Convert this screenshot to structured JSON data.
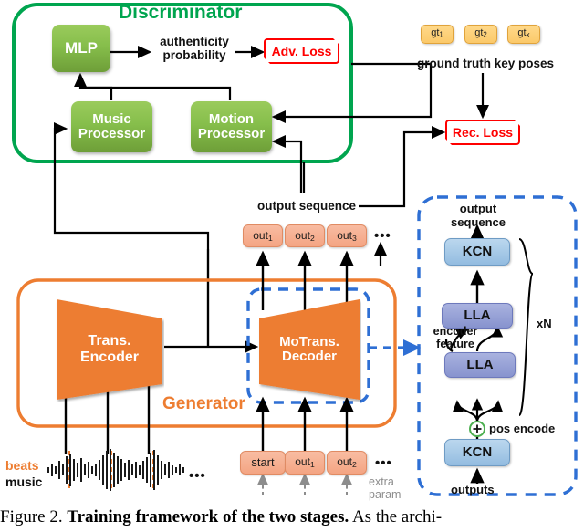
{
  "figure": {
    "caption_prefix": "Figure 2.",
    "caption_bold": "Training framework of the two stages.",
    "caption_rest": "As the archi-"
  },
  "colors": {
    "discriminator_green": "#00A54F",
    "generator_orange": "#ED7D31",
    "decoder_dashed_blue": "#2E6FD4",
    "loss_red": "#FF0000",
    "beats_orange": "#ED7D31",
    "gt_yellow": "#FBC96A",
    "out_salmon": "#F4A583",
    "kcn_blue": "#93BCE0",
    "lla_purple": "#8793CE",
    "gray_text": "#8D8D8D"
  },
  "discriminator": {
    "title": "Discriminator",
    "mlp": "MLP",
    "authenticity": "authenticity\nprobability",
    "authenticity_line1": "authenticity",
    "authenticity_line2": "probability",
    "adv_loss": "Adv. Loss",
    "music_processor_line1": "Music",
    "music_processor_line2": "Processor",
    "motion_processor_line1": "Motion",
    "motion_processor_line2": "Processor"
  },
  "ground_truth": {
    "label": "ground truth key poses",
    "boxes": [
      {
        "base": "gt",
        "sub": "1"
      },
      {
        "base": "gt",
        "sub": "2"
      },
      {
        "base": "gt",
        "sub": "x"
      }
    ]
  },
  "rec_loss": {
    "label": "Rec. Loss"
  },
  "output_sequence_label": "output sequence",
  "generator": {
    "title": "Generator",
    "encoder_line1": "Trans.",
    "encoder_line2": "Encoder",
    "decoder_line1": "MoTrans.",
    "decoder_line2": "Decoder"
  },
  "outputs_row": {
    "boxes": [
      {
        "base": "out",
        "sub": "1"
      },
      {
        "base": "out",
        "sub": "2"
      },
      {
        "base": "out",
        "sub": "3"
      }
    ],
    "ellipsis": "•••"
  },
  "inputs_row": {
    "start_label": "start",
    "boxes": [
      {
        "base": "out",
        "sub": "1"
      },
      {
        "base": "out",
        "sub": "2"
      }
    ],
    "ellipsis": "•••",
    "extra_param_line1": "extra",
    "extra_param_line2": "param"
  },
  "audio": {
    "beats_label": "beats",
    "music_label": "music",
    "ellipsis": "•••"
  },
  "detail_panel": {
    "output_sequence_line1": "output",
    "output_sequence_line2": "sequence",
    "top_kcn": "KCN",
    "upper_lla": "LLA",
    "lower_lla": "LLA",
    "bottom_kcn": "KCN",
    "encoder_feature_line1": "encoder",
    "encoder_feature_line2": "feature",
    "pos_encode": "pos encode",
    "pos_encode_symbol": "+",
    "repeat_label": "xN",
    "outputs_label": "outputs"
  }
}
